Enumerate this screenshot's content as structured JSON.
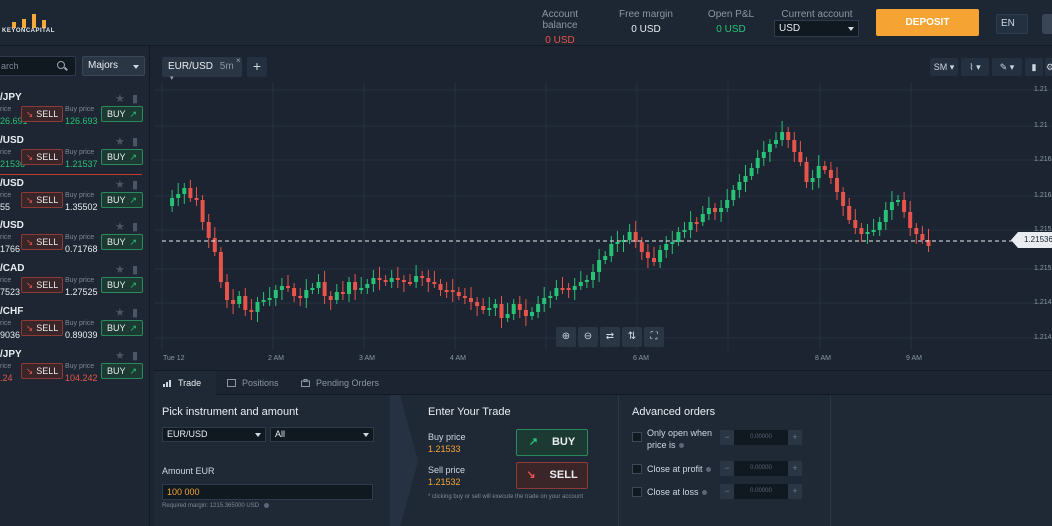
{
  "header": {
    "logo_text": "KEYONCAPITAL",
    "account_balance_label": "Account balance",
    "account_balance": "0 USD",
    "free_margin_label": "Free margin",
    "free_margin": "0 USD",
    "open_pl_label": "Open P&L",
    "open_pl": "0 USD",
    "current_account_label": "Current account",
    "current_account": "USD",
    "deposit_label": "DEPOSIT",
    "language": "EN"
  },
  "sidebar": {
    "search_placeholder": "arch",
    "filter": "Majors",
    "instruments": [
      {
        "name": "/JPY",
        "sell_label": "rice",
        "sell_price": "26.691",
        "sell_color": "green",
        "buy_label": "Buy price",
        "buy_price": "126.693",
        "buy_color": "green"
      },
      {
        "name": "/USD",
        "sell_label": "rice",
        "sell_price": "21536",
        "sell_color": "green",
        "buy_label": "Buy price",
        "buy_price": "1.21537",
        "buy_color": "green"
      },
      {
        "name": "/USD",
        "sell_label": "rice",
        "sell_price": "55",
        "sell_color": "white",
        "buy_label": "Buy price",
        "buy_price": "1.35502",
        "buy_color": "white"
      },
      {
        "name": "/USD",
        "sell_label": "rice",
        "sell_price": "1766",
        "sell_color": "white",
        "buy_label": "Buy price",
        "buy_price": "0.71768",
        "buy_color": "white"
      },
      {
        "name": "/CAD",
        "sell_label": "rice",
        "sell_price": "7523",
        "sell_color": "white",
        "buy_label": "Buy price",
        "buy_price": "1.27525",
        "buy_color": "white"
      },
      {
        "name": "/CHF",
        "sell_label": "rice",
        "sell_price": "9036",
        "sell_color": "white",
        "buy_label": "Buy price",
        "buy_price": "0.89039",
        "buy_color": "white"
      },
      {
        "name": "/JPY",
        "sell_label": "rice",
        "sell_price": ".24",
        "sell_color": "red",
        "buy_label": "Buy price",
        "buy_price": "104.242",
        "buy_color": "red"
      }
    ],
    "sell_btn": "SELL",
    "buy_btn": "BUY"
  },
  "chart": {
    "symbol": "EUR/USD",
    "timeframe": "5m",
    "tools": {
      "sm": "SM",
      "price_tag": "1.21536"
    },
    "x_labels": [
      "Tue 12",
      "2 AM",
      "3 AM",
      "4 AM",
      "6 AM",
      "8 AM",
      "9 AM"
    ],
    "y_labels": [
      "1.21",
      "1.21",
      "1.216",
      "1.216",
      "1.215",
      "1.215",
      "1.214",
      "1.214"
    ]
  },
  "chart_data": {
    "type": "candlestick",
    "title": "",
    "xlabel": "",
    "ylabel": "",
    "current_price": 1.21536
  },
  "bottom": {
    "tabs": [
      "Trade",
      "Positions",
      "Pending Orders"
    ],
    "pick_title": "Pick instrument and amount",
    "instrument": "EUR/USD",
    "group": "All",
    "amount_label": "Amount EUR",
    "amount_value": "100 000",
    "required_margin": "Required margin: 1215.365000 USD",
    "enter_title": "Enter Your Trade",
    "buy_price_label": "Buy price",
    "buy_price": "1.21533",
    "sell_price_label": "Sell price",
    "sell_price": "1.21532",
    "buy_btn": "BUY",
    "sell_btn": "SELL",
    "hint": "* clicking buy or sell will execute the trade on your account",
    "adv_title": "Advanced orders",
    "adv1": "Only open when",
    "adv1b": "price is",
    "adv2": "Close at profit",
    "adv3": "Close at loss",
    "stepper_val": "0.00000"
  }
}
